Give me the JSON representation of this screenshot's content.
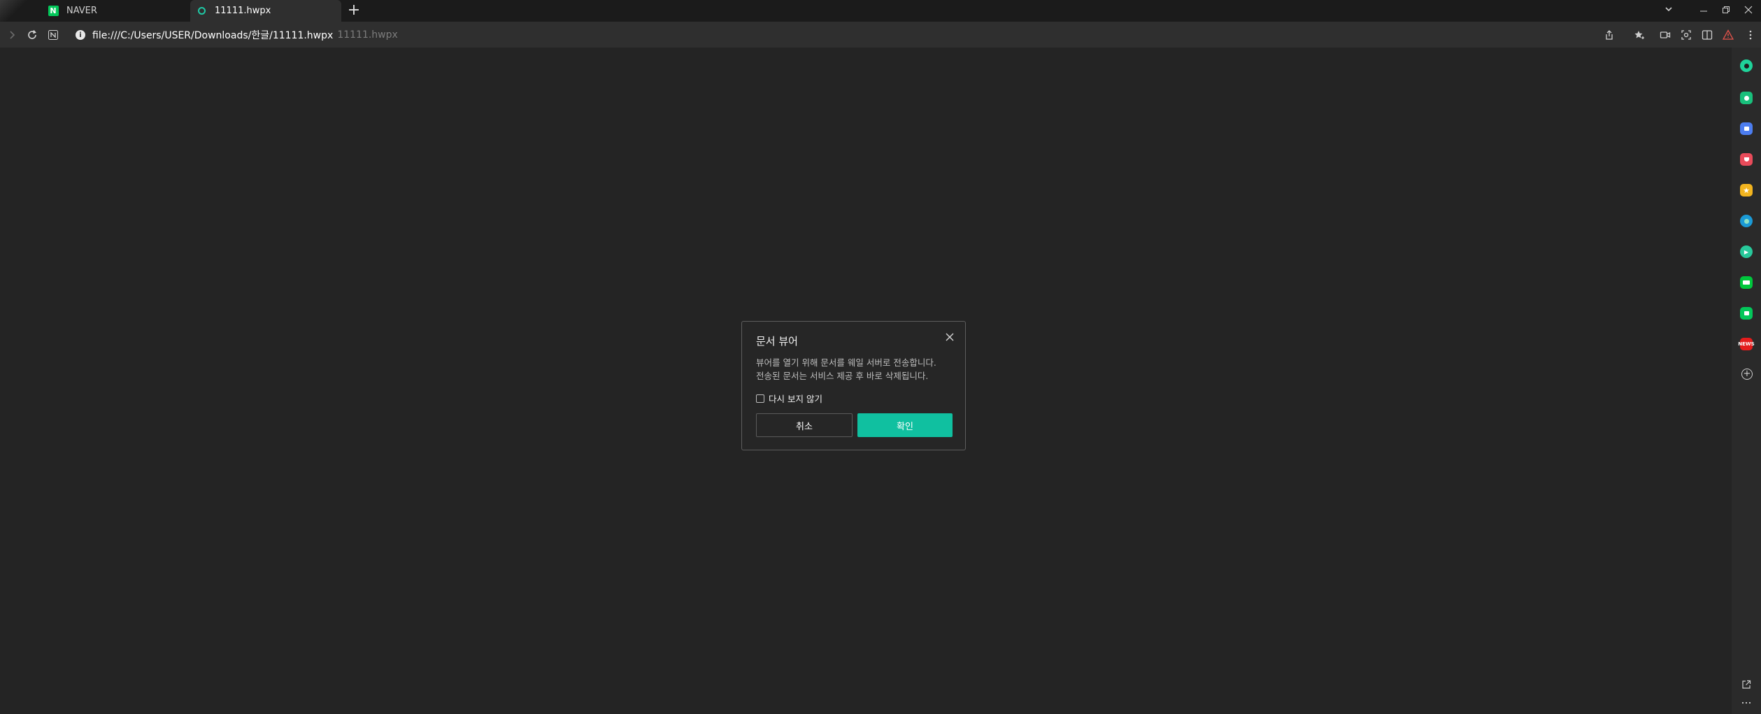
{
  "tabs": [
    {
      "label": "NAVER",
      "icon": "naver-logo-icon"
    },
    {
      "label": "11111.hwpx",
      "icon": "document-viewer-icon",
      "active": true
    }
  ],
  "address_bar": {
    "url": "file:///C:/Users/USER/Downloads/한글/11111.hwpx",
    "page_title": "11111.hwpx"
  },
  "naver_badge": "N",
  "dialog": {
    "title": "문서 뷰어",
    "message_line1": "뷰어를 열기 위해 문서를 웨일 서버로 전송합니다.",
    "message_line2": "전송된 문서는 서비스 제공 후 바로 삭제됩니다.",
    "checkbox_label": "다시 보지 않기",
    "checkbox_checked": false,
    "cancel_label": "취소",
    "ok_label": "확인",
    "ok_color": "#10c0a0"
  },
  "sidebar": {
    "items": [
      {
        "name": "whale-space-icon",
        "color": "#1fd39a"
      },
      {
        "name": "notification-icon",
        "color": "#19c07c"
      },
      {
        "name": "briefcase-icon",
        "color": "#4c7df0"
      },
      {
        "name": "pocket-icon",
        "color": "#e84b5a"
      },
      {
        "name": "favorites-icon",
        "color": "#f2b41f"
      },
      {
        "name": "edge-icon",
        "color": "#1b9ad6"
      },
      {
        "name": "play-icon",
        "color": "#28c99b"
      },
      {
        "name": "webtoon-icon",
        "color": "#00c73c"
      },
      {
        "name": "naver-app-icon",
        "color": "#03c75a"
      },
      {
        "name": "news-icon",
        "color": "#e41c1c",
        "text": "NEWS"
      }
    ]
  }
}
